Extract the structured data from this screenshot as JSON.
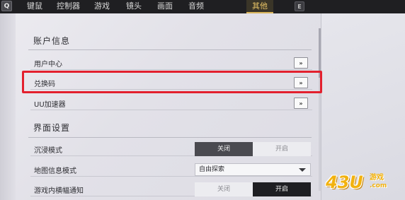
{
  "nav": {
    "prev_key": "Q",
    "next_key": "E",
    "tabs": [
      {
        "label": "键鼠"
      },
      {
        "label": "控制器"
      },
      {
        "label": "游戏"
      },
      {
        "label": "镜头"
      },
      {
        "label": "画面"
      },
      {
        "label": "音频"
      },
      {
        "label": "其他",
        "active": true
      }
    ]
  },
  "account": {
    "title": "账户信息",
    "rows": [
      {
        "label": "用户中心",
        "action": "»"
      },
      {
        "label": "兑换码",
        "action": "»"
      },
      {
        "label": "UU加速器",
        "action": "»"
      }
    ]
  },
  "interface": {
    "title": "界面设置",
    "rows": [
      {
        "label": "沉浸模式",
        "off": "关闭",
        "on": "开启",
        "value": "关闭"
      },
      {
        "label": "地图信息模式",
        "selected": "自由探索"
      },
      {
        "label": "游戏内横幅通知",
        "off": "关闭",
        "on": "开启",
        "value": "开启"
      }
    ]
  },
  "colors": {
    "highlight": "#e3202e",
    "active_tab": "#e9c466"
  },
  "watermark": {
    "logo": "43U",
    "cn": "游戏",
    "domain": ".com"
  }
}
